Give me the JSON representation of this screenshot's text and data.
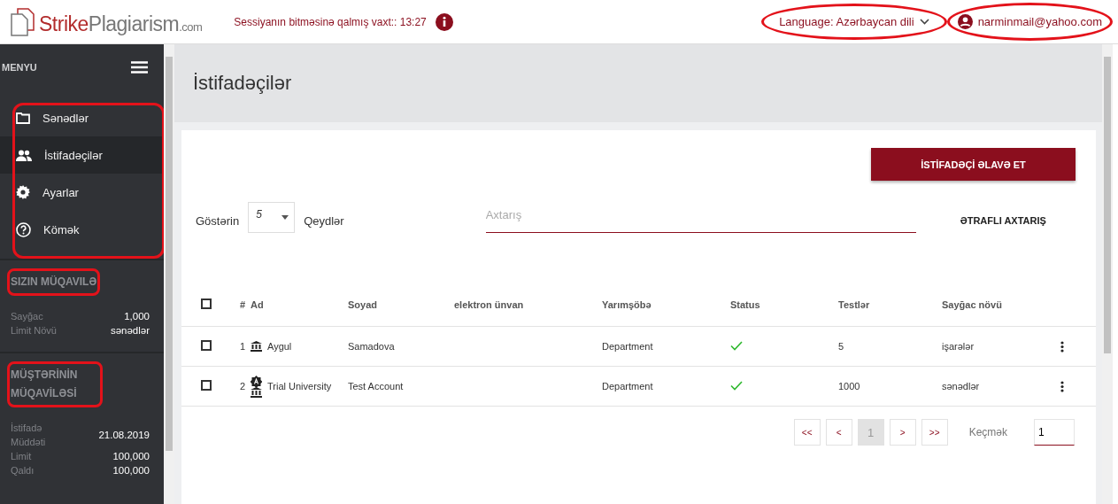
{
  "header": {
    "logo": {
      "strong": "Strike",
      "rest": "Plagiarism",
      "suffix": ".com"
    },
    "session": "Sessiyanın bitməsinə qalmış vaxt:: 13:27",
    "language": {
      "label": "Language: Azərbaycan dili",
      "highlighted": true
    },
    "user": {
      "email": "narminmail@yahoo.com",
      "highlighted": true
    }
  },
  "sidebar": {
    "title": "MENYU",
    "nav_highlighted": true,
    "items": [
      {
        "label": "Sənədlər",
        "kind": "folder",
        "selected": false
      },
      {
        "label": "İstifadəçilər",
        "kind": "users",
        "selected": true
      },
      {
        "label": "Ayarlar",
        "kind": "gear",
        "selected": false
      },
      {
        "label": "Kömək",
        "kind": "help",
        "selected": false
      }
    ],
    "sections": [
      {
        "title": "SIZIN MÜQAVILƏ",
        "highlighted": true,
        "fields": [
          {
            "label": "Sayğac",
            "value": "1,000"
          },
          {
            "label": "Limit Növü",
            "value": "sənədlər"
          }
        ]
      },
      {
        "title": "MÜŞTƏRİNİN MÜQAVİLƏSİ",
        "highlighted": true,
        "fields": [
          {
            "label": "İstifadə Müddəti",
            "value": "21.08.2019"
          },
          {
            "label": "Limit",
            "value": "100,000"
          },
          {
            "label": "Qaldı",
            "value": "100,000"
          }
        ]
      }
    ]
  },
  "page": {
    "title": "İstifadəçilər",
    "add_button": "İSTİFADƏÇİ ƏLAVƏ ET",
    "show_label": "Göstərin",
    "page_size": "5",
    "records_label": "Qeydlər",
    "search": {
      "placeholder": "Axtarış"
    },
    "advanced_search": "ƏTRAFLI AXTARIŞ"
  },
  "table": {
    "select_all_checked": false,
    "columns": [
      "#",
      "Ad",
      "Soyad",
      "elektron ünvan",
      "Yarımşöbə",
      "Status",
      "Testlər",
      "Sayğac növü"
    ],
    "rows": [
      {
        "checked": false,
        "number": "1",
        "kind": "institution",
        "name": "Aygul",
        "surname": "Samadova",
        "email": "",
        "department": "Department",
        "active": true,
        "tests": "5",
        "counter_type": "işarələr"
      },
      {
        "checked": false,
        "number": "2",
        "kind": "admin",
        "name": "Trial University",
        "surname": "Test Account",
        "email": "",
        "department": "Department",
        "active": true,
        "tests": "1000",
        "counter_type": "sənədlər"
      }
    ]
  },
  "pagination": {
    "first": "<<",
    "prev": "<",
    "pages": [
      {
        "label": "1",
        "selected": true
      }
    ],
    "next": ">",
    "last": ">>",
    "goto_label": "Keçmək",
    "goto_value": "1"
  }
}
